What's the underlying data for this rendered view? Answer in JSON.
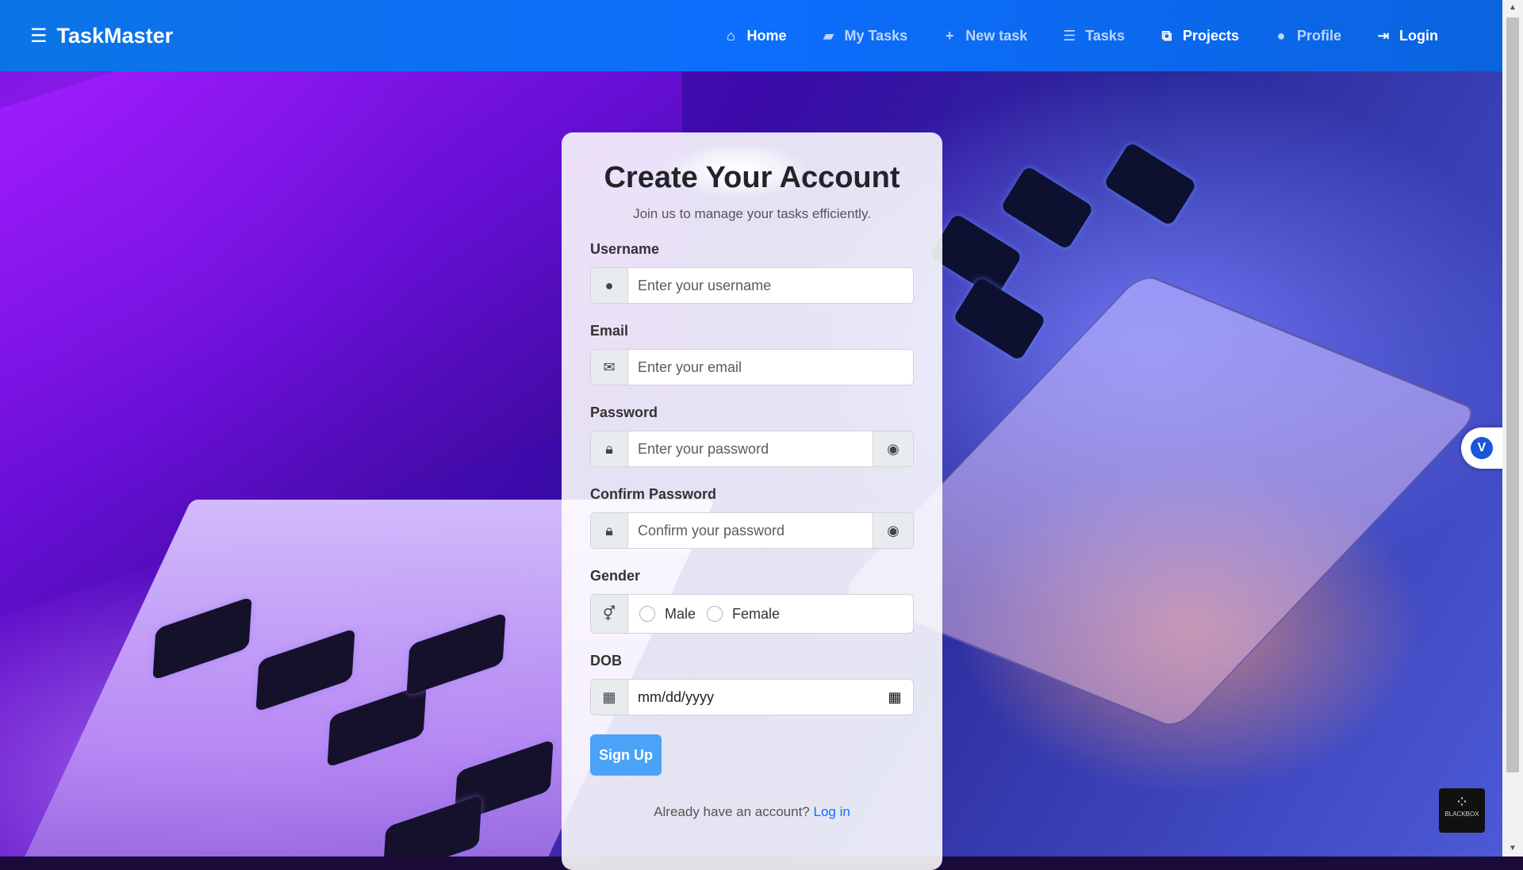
{
  "navbar": {
    "brand": "TaskMaster",
    "items": [
      {
        "label": "Home",
        "icon": "home-icon",
        "active": true
      },
      {
        "label": "My Tasks",
        "icon": "folder-icon",
        "active": false
      },
      {
        "label": "New task",
        "icon": "plus-icon",
        "active": false
      },
      {
        "label": "Tasks",
        "icon": "list-icon",
        "active": false
      },
      {
        "label": "Projects",
        "icon": "sitemap-icon",
        "active": true
      },
      {
        "label": "Profile",
        "icon": "user-icon",
        "active": false
      },
      {
        "label": "Login",
        "icon": "sign-in-icon",
        "active": true
      }
    ]
  },
  "form": {
    "title": "Create Your Account",
    "subtitle": "Join us to manage your tasks efficiently.",
    "username": {
      "label": "Username",
      "placeholder": "Enter your username"
    },
    "email": {
      "label": "Email",
      "placeholder": "Enter your email"
    },
    "password": {
      "label": "Password",
      "placeholder": "Enter your password"
    },
    "confirm_password": {
      "label": "Confirm Password",
      "placeholder": "Confirm your password"
    },
    "gender": {
      "label": "Gender",
      "options": [
        "Male",
        "Female"
      ]
    },
    "dob": {
      "label": "DOB",
      "value": "mm/dd/yyyy"
    },
    "submit_label": "Sign Up",
    "footer_text": "Already have an account?",
    "footer_link": "Log in"
  },
  "widgets": {
    "blackbox_label": "BLACKBOX",
    "side_widget_label": "V"
  },
  "colors": {
    "navbar": "#0d6efd",
    "button": "#4aa3f7",
    "link": "#0d6efd"
  }
}
